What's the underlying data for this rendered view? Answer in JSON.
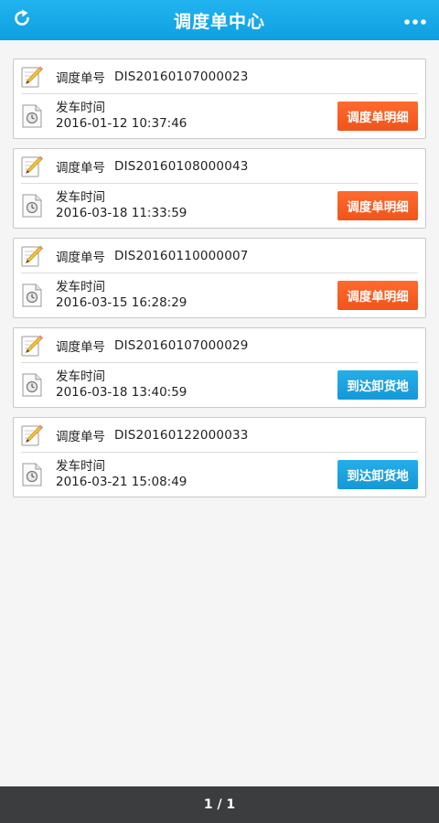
{
  "header": {
    "title": "调度单中心",
    "refresh_icon": "refresh-icon",
    "more_icon": "more-dots-icon"
  },
  "labels": {
    "order_no": "调度单号",
    "depart_time": "发车时间"
  },
  "orders": [
    {
      "order_no": "DIS20160107000023",
      "depart_time": "2016-01-12 10:37:46",
      "action": "调度单明细",
      "action_color": "#f75b21"
    },
    {
      "order_no": "DIS20160108000043",
      "depart_time": "2016-03-18 11:33:59",
      "action": "调度单明细",
      "action_color": "#f75b21"
    },
    {
      "order_no": "DIS20160110000007",
      "depart_time": "2016-03-15 16:28:29",
      "action": "调度单明细",
      "action_color": "#f75b21"
    },
    {
      "order_no": "DIS20160107000029",
      "depart_time": "2016-03-18 13:40:59",
      "action": "到达卸货地",
      "action_color": "#1da3e0"
    },
    {
      "order_no": "DIS20160122000033",
      "depart_time": "2016-03-21 15:08:49",
      "action": "到达卸货地",
      "action_color": "#1da3e0"
    }
  ],
  "footer": {
    "pager": "1 / 1"
  },
  "colors": {
    "header_bg": "#18a9e9",
    "footer_bg": "#3c3d3f",
    "orange": "#f75b21",
    "blue": "#1da3e0"
  }
}
